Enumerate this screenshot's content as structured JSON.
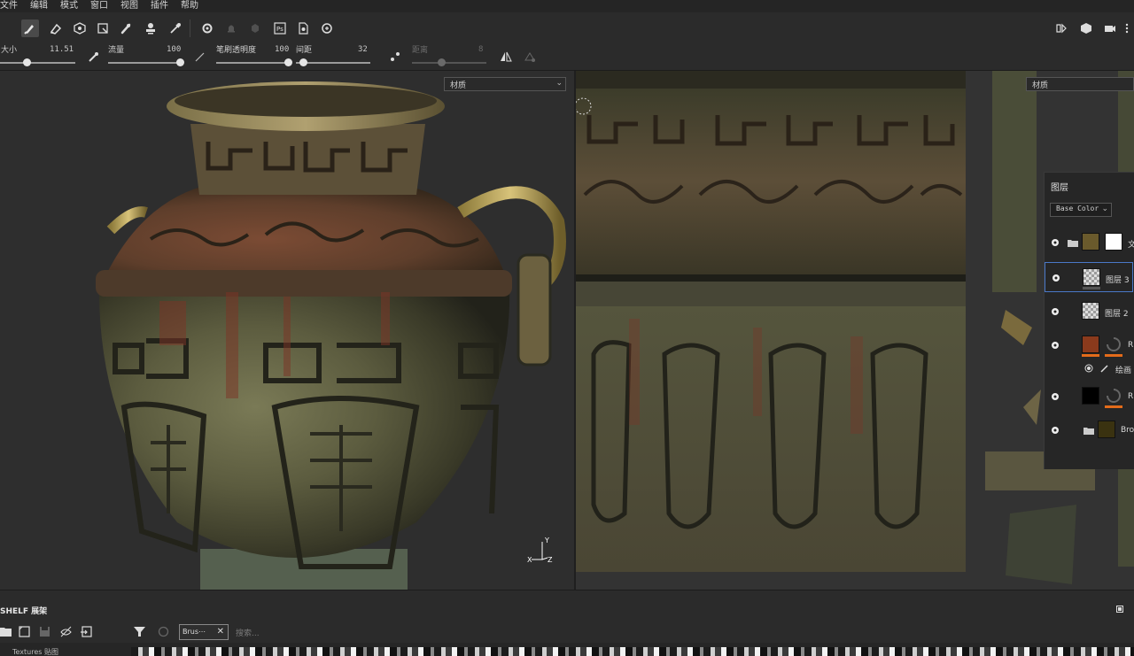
{
  "menu": [
    "文件",
    "编辑",
    "模式",
    "窗口",
    "视图",
    "插件",
    "帮助"
  ],
  "props": {
    "size_label": "大小",
    "size_value": "11.51",
    "flow_label": "流量",
    "flow_value": "100",
    "opacity_label": "笔刷透明度",
    "opacity_value": "100",
    "spacing_label": "间距",
    "spacing_value": "32",
    "jitter_label": "距离",
    "jitter_value": "8"
  },
  "viewport3d": {
    "material_dropdown": "材质",
    "axis_y": "Y",
    "axis_x": "X",
    "axis_z": "Z"
  },
  "viewport2d": {
    "material_dropdown": "材质"
  },
  "layers": {
    "title": "图层",
    "channel": "Base Color",
    "rows": [
      {
        "name": "文"
      },
      {
        "name": "图层 3"
      },
      {
        "name": "图层 2"
      },
      {
        "name": "R"
      },
      {
        "name": "绘画"
      },
      {
        "name": "R"
      },
      {
        "name": "Bro"
      }
    ]
  },
  "shelf": {
    "title": "SHELF 展架",
    "tag": "Brus⋯",
    "search_placeholder": "搜索...",
    "category": "Textures 贴图"
  }
}
